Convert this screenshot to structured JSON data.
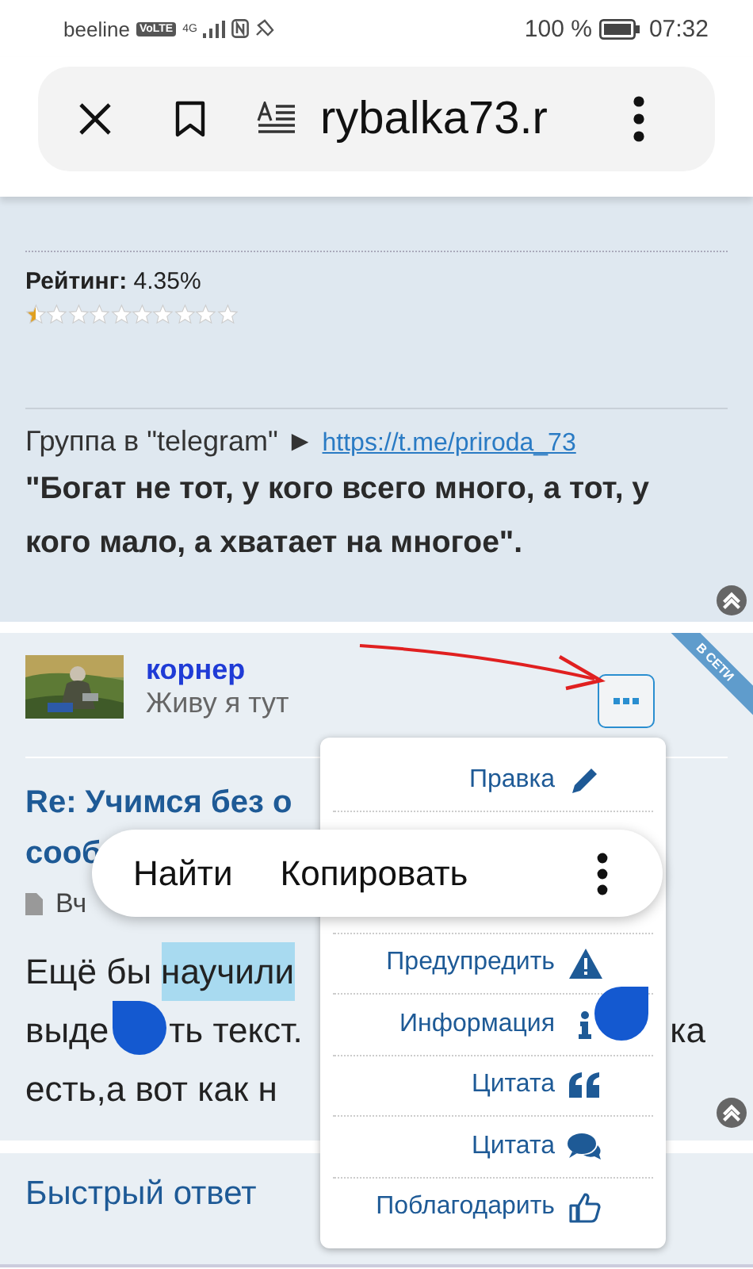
{
  "status_bar": {
    "carrier": "beeline",
    "volte": "VoLTE",
    "network": "4G",
    "battery_text": "100 %",
    "time": "07:32"
  },
  "address_bar": {
    "url": "rybalka73.r"
  },
  "profile": {
    "rating_label": "Рейтинг:",
    "rating_value": "4.35%",
    "stars": 0.5,
    "telegram_text": "Группа в \"telegram\" ►",
    "telegram_link": "https://t.me/priroda_73",
    "quote": "\"Богат не тот, у кого всего много, а тот, у кого мало, а хватает на многое\"."
  },
  "post": {
    "author": "корнер",
    "status": "Живу я тут",
    "online_badge": "В СЕТИ",
    "title_lines": [
      "Re: Учимся без о",
      "сооб"
    ],
    "meta": "Вч",
    "body_lines": [
      {
        "parts": [
          {
            "text": "Ещё бы",
            "selected": false
          },
          {
            "text": "научили",
            "selected": true
          }
        ]
      },
      {
        "parts": [
          {
            "text": "выде",
            "selected": false
          },
          {
            "text": "ть текст.",
            "selected": false
          }
        ],
        "tail": "ка"
      },
      {
        "parts": [
          {
            "text": "есть,а вот как н",
            "selected": false
          }
        ]
      }
    ]
  },
  "quick_reply": "Быстрый ответ",
  "post_menu": {
    "items": [
      {
        "label": "Правка",
        "kind": "edit"
      },
      {
        "label": "Предупредить",
        "kind": "warn"
      },
      {
        "label": "Информация",
        "kind": "info"
      },
      {
        "label": "Цитата",
        "kind": "quote"
      },
      {
        "label": "Цитата",
        "kind": "reply"
      },
      {
        "label": "Поблагодарить",
        "kind": "thank"
      }
    ]
  },
  "selection_popup": {
    "actions": [
      "Найти",
      "Копировать"
    ]
  }
}
